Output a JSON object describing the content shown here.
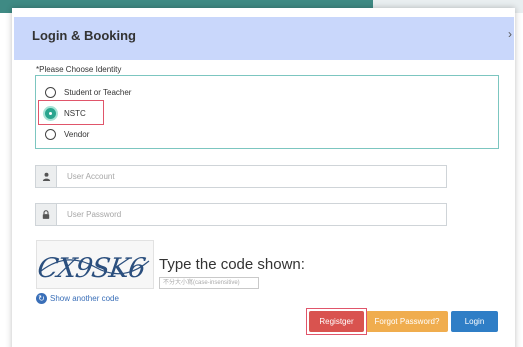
{
  "header": {
    "title": "Login & Booking",
    "chevron": "›"
  },
  "identity": {
    "label": "*Please Choose Identity",
    "options": [
      {
        "label": "Student or Teacher",
        "checked": false
      },
      {
        "label": "NSTC",
        "checked": true
      },
      {
        "label": "Vendor",
        "checked": false
      }
    ]
  },
  "account": {
    "placeholder": "User Account",
    "icon": "user-icon"
  },
  "password": {
    "placeholder": "User Password",
    "icon": "lock-icon"
  },
  "captcha": {
    "code": "CX9SK6",
    "caption": "Type the code shown:",
    "input_placeholder": "不分大小寫(case-insensitive)",
    "refresh_label": "Show another code",
    "refresh_icon": "refresh-icon"
  },
  "buttons": {
    "register": "Registger",
    "forgot": "Forgot Password?",
    "login": "Login"
  },
  "colors": {
    "header_bg": "#c9d7fb",
    "identity_border": "#7cc6c0",
    "radio_checked": "#2aa58f",
    "highlight": "#e0556a",
    "register_bg": "#d9534f",
    "forgot_bg": "#f0ad4e",
    "login_bg": "#2f7ec6",
    "link": "#3a6fb8"
  }
}
